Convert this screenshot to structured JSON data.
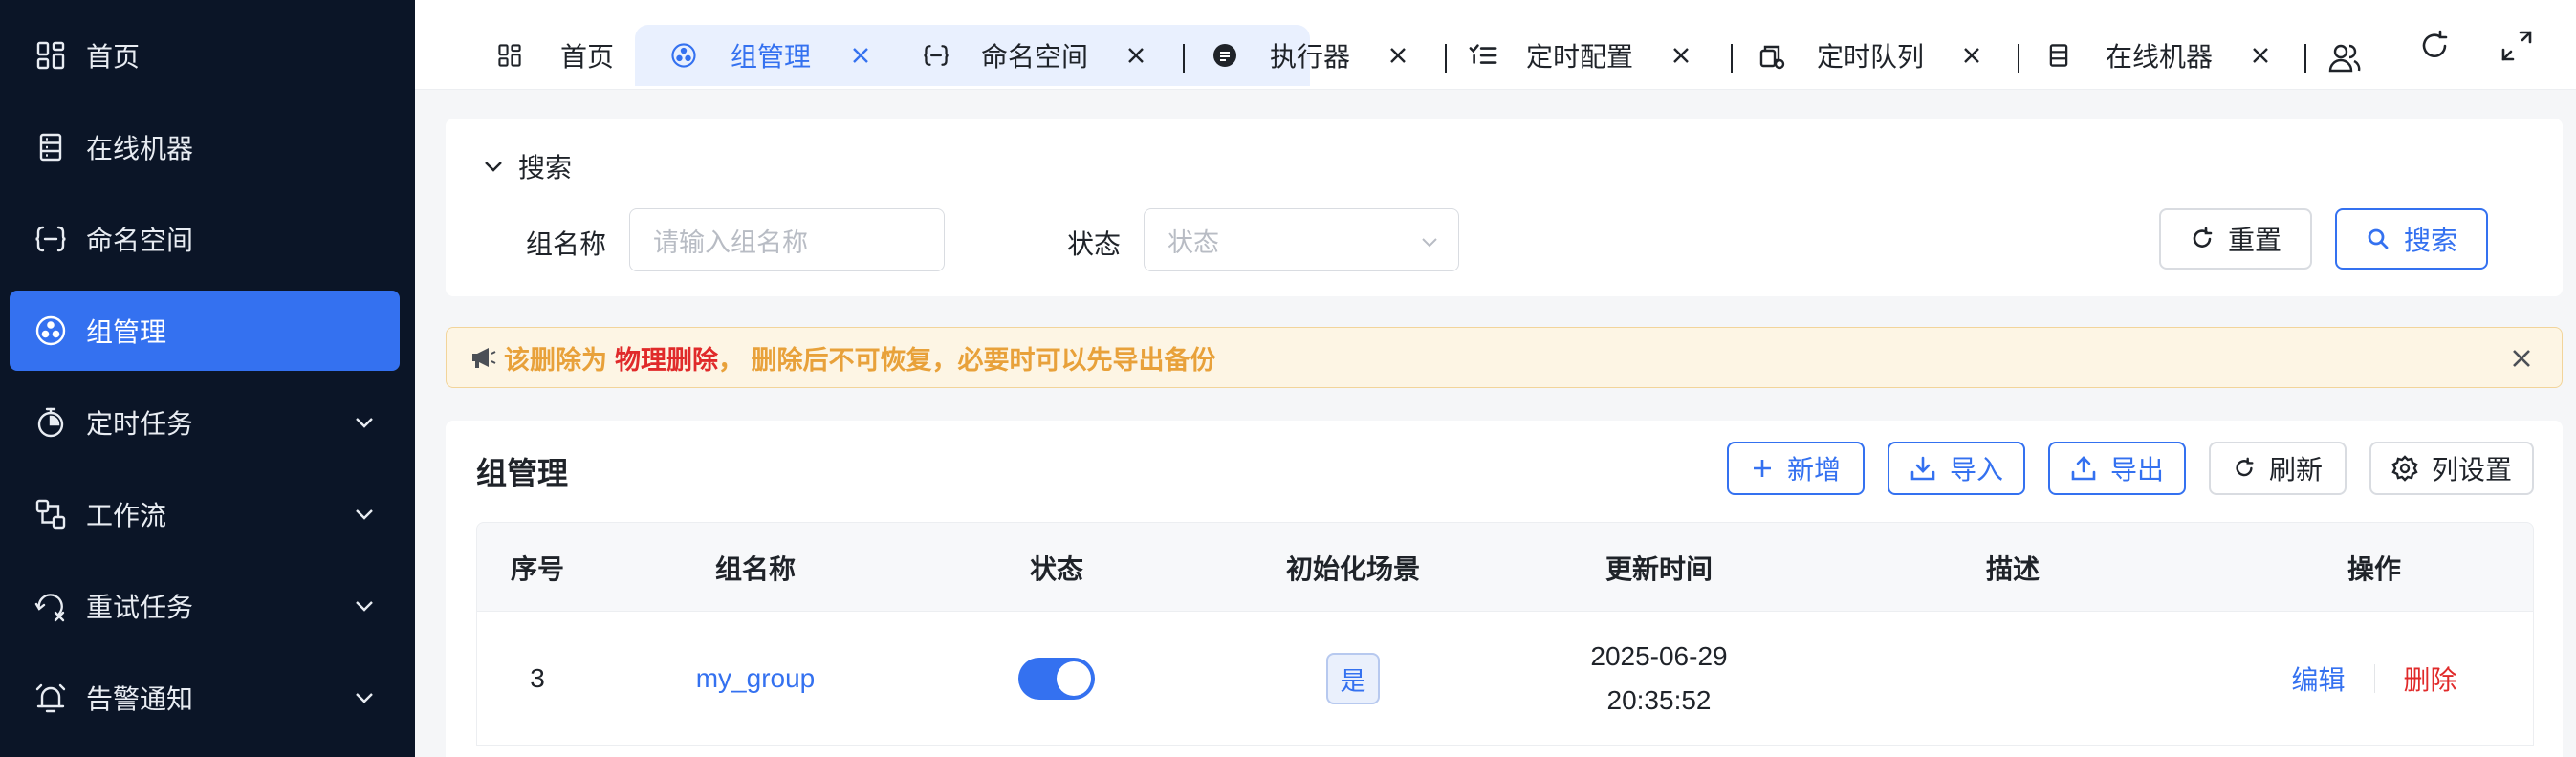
{
  "sidebar": {
    "items": [
      {
        "label": "首页",
        "icon": "dashboard-icon"
      },
      {
        "label": "在线机器",
        "icon": "server-icon"
      },
      {
        "label": "命名空间",
        "icon": "namespace-icon"
      },
      {
        "label": "组管理",
        "icon": "group-icon",
        "active": true
      },
      {
        "label": "定时任务",
        "icon": "timer-icon",
        "expandable": true
      },
      {
        "label": "工作流",
        "icon": "workflow-icon",
        "expandable": true
      },
      {
        "label": "重试任务",
        "icon": "retry-icon",
        "expandable": true
      },
      {
        "label": "告警通知",
        "icon": "alarm-icon",
        "expandable": true
      }
    ]
  },
  "tabs": [
    {
      "label": "首页",
      "icon": "dashboard-icon",
      "closable": false
    },
    {
      "label": "组管理",
      "icon": "group-icon",
      "closable": true,
      "active": true
    },
    {
      "label": "命名空间",
      "icon": "namespace-icon",
      "closable": true
    },
    {
      "label": "执行器",
      "icon": "executor-icon",
      "closable": true
    },
    {
      "label": "定时配置",
      "icon": "checklist-icon",
      "closable": true
    },
    {
      "label": "定时队列",
      "icon": "queue-icon",
      "closable": true
    },
    {
      "label": "在线机器",
      "icon": "server-icon",
      "closable": true
    }
  ],
  "search": {
    "title": "搜索",
    "group_name_label": "组名称",
    "group_name_placeholder": "请输入组名称",
    "status_label": "状态",
    "status_placeholder": "状态",
    "reset_label": "重置",
    "search_label": "搜索"
  },
  "alert": {
    "prefix": "该删除为",
    "highlight": "物理删除",
    "suffix": "， 删除后不可恢复，必要时可以先导出备份"
  },
  "table": {
    "title": "组管理",
    "toolbar": {
      "add": "新增",
      "import": "导入",
      "export": "导出",
      "refresh": "刷新",
      "columns": "列设置"
    },
    "columns": [
      "序号",
      "组名称",
      "状态",
      "初始化场景",
      "更新时间",
      "描述",
      "操作"
    ],
    "rows": [
      {
        "index": "3",
        "group_name": "my_group",
        "status_on": true,
        "init_scene": "是",
        "update_date": "2025-06-29",
        "update_time": "20:35:52",
        "description": "",
        "edit": "编辑",
        "delete": "删除"
      }
    ]
  },
  "colors": {
    "primary": "#3471f0",
    "sidebar_bg": "#0b1527",
    "danger": "#e02a2a",
    "warning_text": "#e8a13a"
  }
}
